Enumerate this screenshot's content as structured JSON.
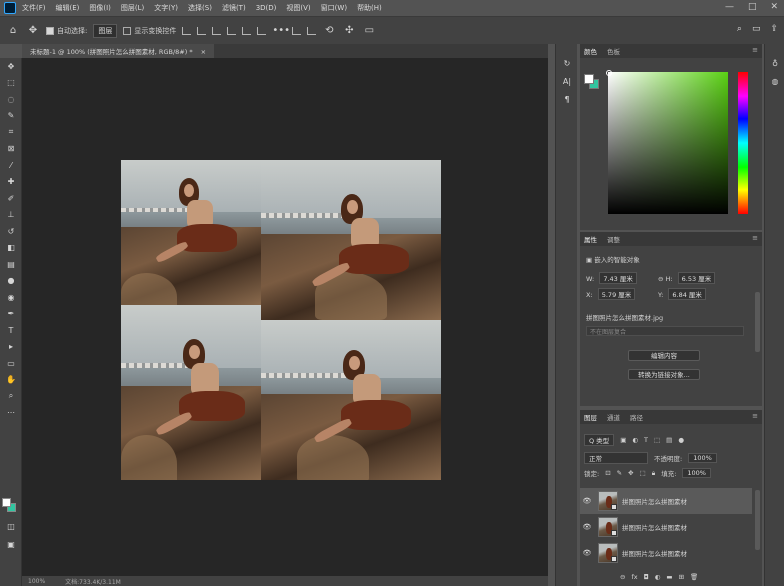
{
  "menu": {
    "items": [
      "文件(F)",
      "编辑(E)",
      "图像(I)",
      "图层(L)",
      "文字(Y)",
      "选择(S)",
      "滤镜(T)",
      "3D(D)",
      "视图(V)",
      "窗口(W)",
      "帮助(H)"
    ],
    "controls": [
      "—",
      "□",
      "✕"
    ]
  },
  "options": {
    "auto_select_label": "自动选择:",
    "auto_select_value": "图层",
    "show_transform_label": "显示变换控件",
    "more": "•••"
  },
  "document": {
    "tab_title": "未标题-1 @ 100% (拼图照片怎么拼图素材, RGB/8#) *",
    "close": "×"
  },
  "colors": {
    "foreground": "#ffffff",
    "background": "#31c5a0",
    "picker_hue": "#5ad014"
  },
  "color_panel": {
    "tabs": [
      "颜色",
      "色板"
    ]
  },
  "properties_panel": {
    "tabs": [
      "属性",
      "调整"
    ],
    "object_type": "嵌入的智能对象",
    "w_label": "W:",
    "w_value": "7.43 厘米",
    "h_label": "H:",
    "h_value": "6.53 厘米",
    "x_label": "X:",
    "x_value": "5.79 厘米",
    "y_label": "Y:",
    "y_value": "6.84 厘米",
    "filename": "拼图照片怎么拼图素材.jpg",
    "comp_placeholder": "不在图层复合",
    "edit_button": "编辑内容",
    "convert_button": "转换为链接对象..."
  },
  "layers_panel": {
    "tabs": [
      "图层",
      "通道",
      "路径"
    ],
    "filter_label": "Q 类型",
    "blend_mode": "正常",
    "opacity_label": "不透明度:",
    "opacity_value": "100%",
    "lock_label": "锁定:",
    "fill_label": "填充:",
    "fill_value": "100%",
    "layers": [
      {
        "name": "拼图照片怎么拼图素材",
        "selected": true
      },
      {
        "name": "拼图照片怎么拼图素材",
        "selected": false
      },
      {
        "name": "拼图照片怎么拼图素材",
        "selected": false
      }
    ]
  },
  "status": {
    "zoom": "100%",
    "doc": "文档:733.4K/3.11M"
  }
}
